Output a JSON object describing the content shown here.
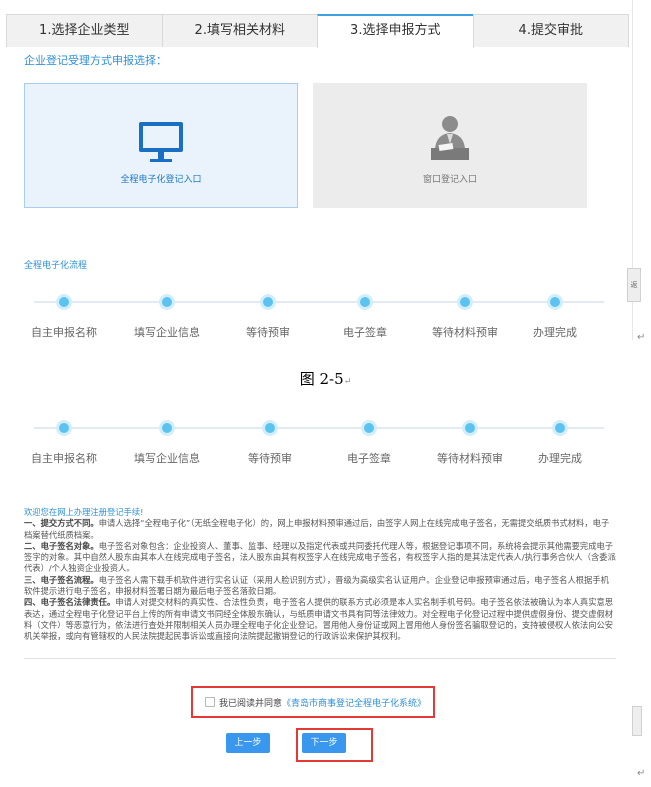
{
  "tabs": [
    {
      "label": "1.选择企业类型",
      "active": false
    },
    {
      "label": "2.填写相关材料",
      "active": false
    },
    {
      "label": "3.选择申报方式",
      "active": true
    },
    {
      "label": "4.提交审批",
      "active": false
    }
  ],
  "section_title": "企业登记受理方式申报选择：",
  "entries": {
    "online": {
      "label": "全程电子化登记入口",
      "icon": "monitor-icon"
    },
    "window": {
      "label": "窗口登记入口",
      "icon": "clerk-icon"
    }
  },
  "flow_title": "全程电子化流程",
  "flow_steps": [
    "自主申报名称",
    "填写企业信息",
    "等待预审",
    "电子签章",
    "等待材料预审",
    "办理完成"
  ],
  "scroll_hint": "返",
  "caption": {
    "figure": "图 2-5",
    "mark": "↵"
  },
  "paragraph_mark": "↵",
  "notice": {
    "title": "欢迎您在网上办理注册登记手续!",
    "items": [
      {
        "head": "一、提交方式不同。",
        "body": "申请人选择“全程电子化”（无纸全程电子化）的，网上申报材料预审通过后，由签字人网上在线完成电子签名，无需提交纸质书式材料，电子档案替代纸质档案。"
      },
      {
        "head": "二、电子签名对象。",
        "body": "电子签名对象包含：企业投资人、董事、监事、经理以及指定代表或共同委托代理人等，根据登记事项不同，系统将会提示其他需要完成电子签字的对象。其中自然人股东由其本人在线完成电子签名，法人股东由其有权签字人在线完成电子签名，有权签字人指的是其法定代表人/执行事务合伙人（含委派代表）/个人独资企业投资人。"
      },
      {
        "head": "三、电子签名流程。",
        "body": "电子签名人需下载手机软件进行实名认证（采用人脸识别方式），晋级为高级实名认证用户。企业登记申报预审通过后，电子签名人根据手机软件提示进行电子签名，申报材料签署日期为最后电子签名落款日期。"
      },
      {
        "head": "四、电子签名法律责任。",
        "body": "申请人对提交材料的真实性、合法性负责，电子签名人提供的联系方式必须是本人实名制手机号码。电子签名依法被确认为本人真实意思表达，通过全程电子化登记平台上传的所有申请文书同经全体股东确认，与纸质申请文书具有同等法律效力。对全程电子化登记过程中提供虚假身份、提交虚假材料（文件）等恶意行为，依法进行查处并限制相关人员办理全程电子化企业登记。冒用他人身份证或网上冒用他人身份签名骗取登记的，支持被侵权人依法向公安机关举报，或向有管辖权的人民法院提起民事诉讼或直接向法院提起撤销登记的行政诉讼来保护其权利。"
      }
    ]
  },
  "agree": {
    "text": "我已阅读并同意",
    "link": "《青岛市商事登记全程电子化系统》",
    "checked": false
  },
  "buttons": {
    "prev": "上一步",
    "next": "下一步"
  },
  "colors": {
    "accent": "#3a97ee",
    "highlight_border": "#e53935",
    "flow_dot": "#5cc3f0"
  }
}
